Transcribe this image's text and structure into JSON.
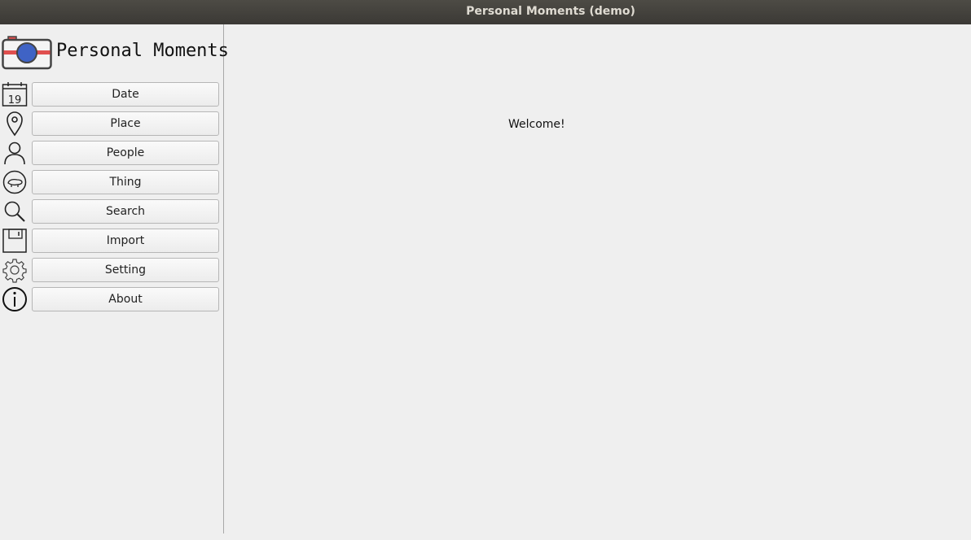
{
  "window": {
    "title": "Personal Moments (demo)"
  },
  "app": {
    "name": "Personal Moments",
    "logo_icon": "camera-icon"
  },
  "nav": [
    {
      "label": "Date",
      "icon": "calendar-icon",
      "calendar_day": "19"
    },
    {
      "label": "Place",
      "icon": "location-pin-icon"
    },
    {
      "label": "People",
      "icon": "person-icon"
    },
    {
      "label": "Thing",
      "icon": "thing-icon"
    },
    {
      "label": "Search",
      "icon": "search-icon"
    },
    {
      "label": "Import",
      "icon": "floppy-disk-icon"
    },
    {
      "label": "Setting",
      "icon": "gear-icon"
    },
    {
      "label": "About",
      "icon": "info-icon"
    }
  ],
  "main": {
    "welcome": "Welcome!"
  },
  "colors": {
    "titlebar_bg": "#3f3d39",
    "titlebar_text": "#dfdbd2",
    "window_bg": "#efefef",
    "camera_accent": "#e0504f",
    "camera_lens": "#3f63c5"
  }
}
